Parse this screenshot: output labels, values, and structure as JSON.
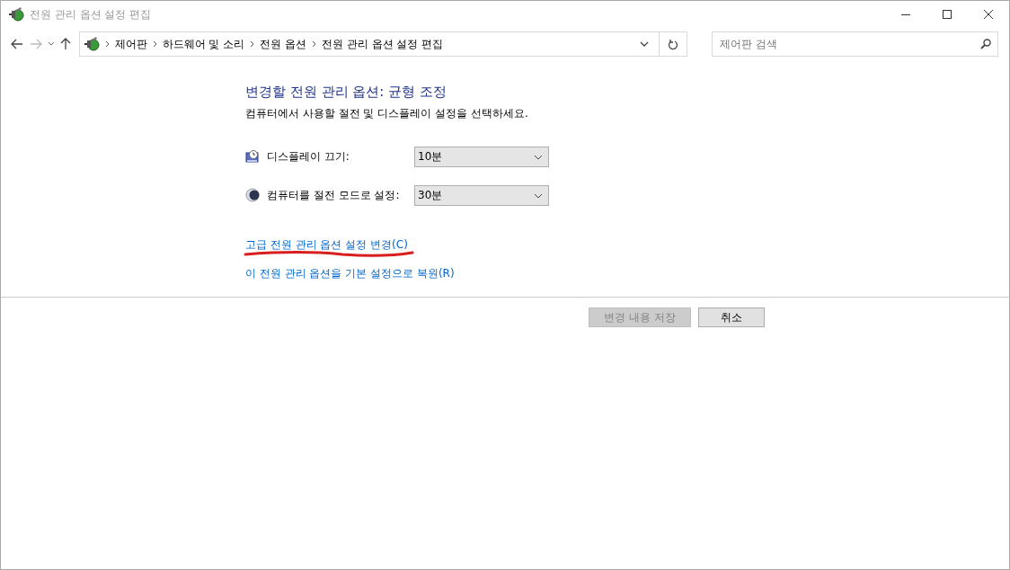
{
  "window": {
    "title": "전원 관리 옵션 설정 편집"
  },
  "breadcrumb": [
    "제어판",
    "하드웨어 및 소리",
    "전원 옵션",
    "전원 관리 옵션 설정 편집"
  ],
  "search": {
    "placeholder": "제어판 검색"
  },
  "heading": "변경할 전원 관리 옵션: 균형 조정",
  "description": "컴퓨터에서 사용할 절전 및 디스플레이 설정을 선택하세요.",
  "settings": [
    {
      "kind": "display",
      "label": "디스플레이 끄기:",
      "value": "10분"
    },
    {
      "kind": "sleep",
      "label": "컴퓨터를 절전 모드로 설정:",
      "value": "30분"
    }
  ],
  "links": [
    {
      "text": "고급 전원 관리 옵션 설정 변경(C)",
      "annotated": true
    },
    {
      "text": "이 전원 관리 옵션을 기본 설정으로 복원(R)",
      "annotated": false
    }
  ],
  "buttons": [
    {
      "label": "변경 내용 저장",
      "disabled": true
    },
    {
      "label": "취소",
      "disabled": false
    }
  ]
}
